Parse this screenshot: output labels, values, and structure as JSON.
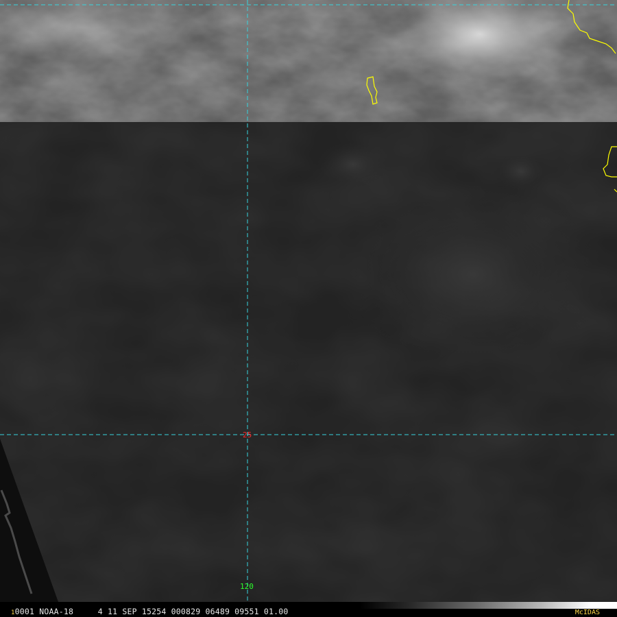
{
  "map": {
    "lat_label": "25",
    "lon_label": "120",
    "colors": {
      "grid": "#37d4de",
      "coastline": "#ffff00",
      "lat_label": "#ff2a2a",
      "lon_label": "#2cff2c"
    }
  },
  "status_bar": {
    "frame_number": "1",
    "text": "0001 NOAA-18     4 11 SEP 15254 000829 06489 09551 01.00",
    "brand": "McIDAS"
  }
}
